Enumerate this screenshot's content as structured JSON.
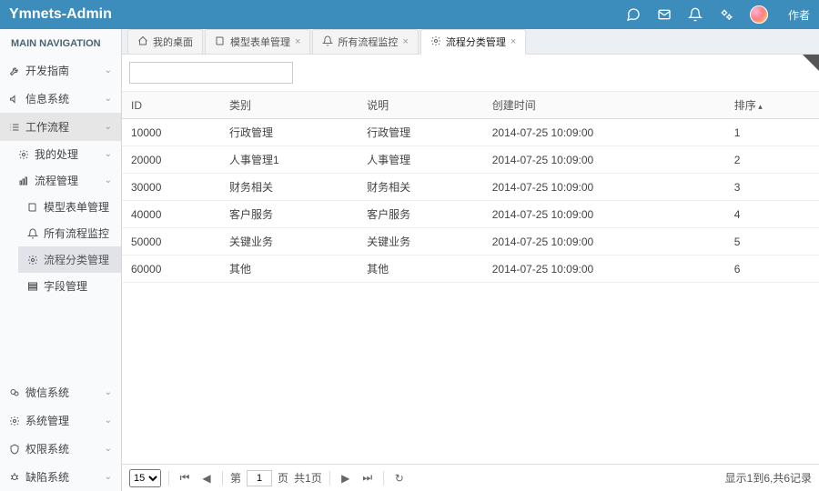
{
  "header": {
    "logo": "Ymnets-Admin",
    "user_label": "作者"
  },
  "sidebar": {
    "header": "MAIN NAVIGATION",
    "items": [
      {
        "icon": "wrench",
        "label": "开发指南",
        "expand": true
      },
      {
        "icon": "speaker",
        "label": "信息系统",
        "expand": true
      },
      {
        "icon": "list",
        "label": "工作流程",
        "expand": true,
        "active": true,
        "children": [
          {
            "icon": "gear",
            "label": "我的处理",
            "expand": true
          },
          {
            "icon": "chart",
            "label": "流程管理",
            "expand": true,
            "children": [
              {
                "icon": "book",
                "label": "模型表单管理"
              },
              {
                "icon": "bell",
                "label": "所有流程监控"
              },
              {
                "icon": "gear",
                "label": "流程分类管理",
                "selected": true
              },
              {
                "icon": "list2",
                "label": "字段管理"
              }
            ]
          }
        ]
      },
      {
        "icon": "wechat",
        "label": "微信系统",
        "expand": true
      },
      {
        "icon": "gear",
        "label": "系统管理",
        "expand": true
      },
      {
        "icon": "shield",
        "label": "权限系统",
        "expand": true
      },
      {
        "icon": "bug",
        "label": "缺陷系统",
        "expand": true
      }
    ]
  },
  "tabs": [
    {
      "icon": "home",
      "label": "我的桌面"
    },
    {
      "icon": "book",
      "label": "模型表单管理",
      "closable": true
    },
    {
      "icon": "bell",
      "label": "所有流程监控",
      "closable": true
    },
    {
      "icon": "gear",
      "label": "流程分类管理",
      "closable": true,
      "active": true
    }
  ],
  "grid": {
    "columns": [
      {
        "key": "id",
        "label": "ID"
      },
      {
        "key": "cat",
        "label": "类别"
      },
      {
        "key": "desc",
        "label": "说明"
      },
      {
        "key": "created",
        "label": "创建时间"
      },
      {
        "key": "sort",
        "label": "排序",
        "sort": true
      }
    ],
    "rows": [
      {
        "id": "10000",
        "cat": "行政管理",
        "desc": "行政管理",
        "created": "2014-07-25 10:09:00",
        "sort": "1"
      },
      {
        "id": "20000",
        "cat": "人事管理1",
        "desc": "人事管理",
        "created": "2014-07-25 10:09:00",
        "sort": "2"
      },
      {
        "id": "30000",
        "cat": "财务相关",
        "desc": "财务相关",
        "created": "2014-07-25 10:09:00",
        "sort": "3"
      },
      {
        "id": "40000",
        "cat": "客户服务",
        "desc": "客户服务",
        "created": "2014-07-25 10:09:00",
        "sort": "4"
      },
      {
        "id": "50000",
        "cat": "关键业务",
        "desc": "关键业务",
        "created": "2014-07-25 10:09:00",
        "sort": "5"
      },
      {
        "id": "60000",
        "cat": "其他",
        "desc": "其他",
        "created": "2014-07-25 10:09:00",
        "sort": "6"
      }
    ]
  },
  "pager": {
    "page_size": "15",
    "page_label_prefix": "第",
    "page_value": "1",
    "page_label_suffix": "页",
    "total_pages": "共1页",
    "summary": "显示1到6,共6记录"
  }
}
